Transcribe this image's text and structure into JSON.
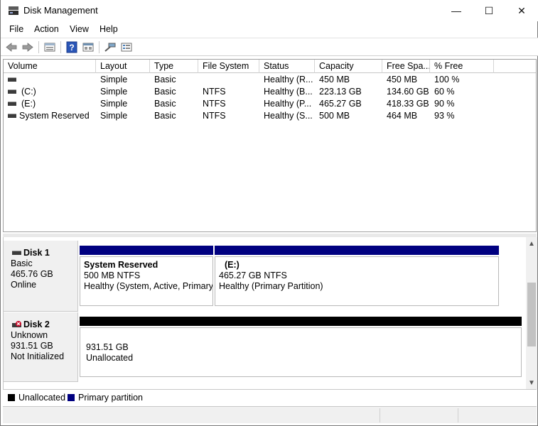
{
  "window": {
    "title": "Disk Management",
    "minimize_glyph": "—",
    "maximize_glyph": "☐",
    "close_glyph": "✕"
  },
  "menu": [
    "File",
    "Action",
    "View",
    "Help"
  ],
  "toolbar": {
    "buttons": [
      "back-icon",
      "forward-icon",
      "disk-list-icon",
      "help-icon",
      "properties-icon",
      "connect-icon",
      "settings-icon"
    ]
  },
  "volume_list": {
    "columns": [
      "Volume",
      "Layout",
      "Type",
      "File System",
      "Status",
      "Capacity",
      "Free Spa...",
      "% Free"
    ],
    "rows": [
      {
        "volume": "",
        "layout": "Simple",
        "type": "Basic",
        "fs": "",
        "status": "Healthy (R...",
        "capacity": "450 MB",
        "free": "450 MB",
        "pct": "100 %"
      },
      {
        "volume": "(C:)",
        "layout": "Simple",
        "type": "Basic",
        "fs": "NTFS",
        "status": "Healthy (B...",
        "capacity": "223.13 GB",
        "free": "134.60 GB",
        "pct": "60 %"
      },
      {
        "volume": "(E:)",
        "layout": "Simple",
        "type": "Basic",
        "fs": "NTFS",
        "status": "Healthy (P...",
        "capacity": "465.27 GB",
        "free": "418.33 GB",
        "pct": "90 %"
      },
      {
        "volume": "System Reserved",
        "layout": "Simple",
        "type": "Basic",
        "fs": "NTFS",
        "status": "Healthy (S...",
        "capacity": "500 MB",
        "free": "464 MB",
        "pct": "93 %"
      }
    ]
  },
  "disks": [
    {
      "name": "Disk 1",
      "type": "Basic",
      "size": "465.76 GB",
      "state": "Online",
      "partitions": [
        {
          "title": "System Reserved",
          "size": "500 MB NTFS",
          "status": "Healthy (System, Active, Primary"
        },
        {
          "title": "(E:)",
          "size": "465.27 GB NTFS",
          "status": "Healthy (Primary Partition)"
        }
      ]
    },
    {
      "name": "Disk 2",
      "type": "Unknown",
      "size": "931.51 GB",
      "state": "Not Initialized",
      "partitions": [
        {
          "size": "931.51 GB",
          "status": "Unallocated"
        }
      ]
    }
  ],
  "legend": {
    "unallocated": "Unallocated",
    "primary": "Primary partition",
    "unallocated_color": "#000000",
    "primary_color": "#000080"
  },
  "scroll": {
    "up": "▲",
    "down": "▼"
  }
}
